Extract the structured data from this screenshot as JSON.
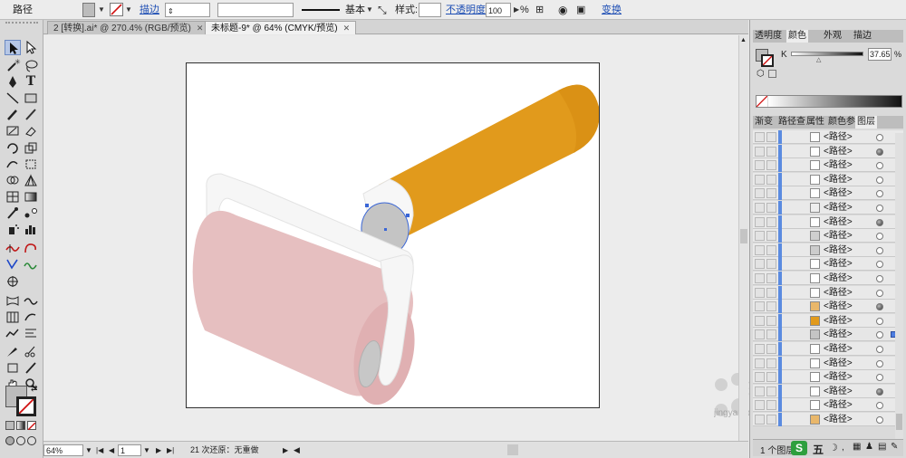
{
  "control_bar": {
    "selection_type": "路径",
    "stroke_link": "描边",
    "stroke_profile": "基本",
    "style_label": "样式:",
    "opacity_link": "不透明度",
    "opacity_value": "100",
    "opacity_unit": "%",
    "transform_link": "变换"
  },
  "tabs": [
    {
      "label": "2 [转换].ai* @ 270.4% (RGB/预览)",
      "close": "✕"
    },
    {
      "label": "未标题-9* @ 64% (CMYK/预览)",
      "close": "✕"
    }
  ],
  "status_bar": {
    "zoom": "64%",
    "page": "1",
    "undo_text": "21 次还原：无重做"
  },
  "color_panel": {
    "tabs": [
      "透明度",
      "颜色",
      "外观",
      "描边"
    ],
    "active_tab": "颜色",
    "channel_label": "K",
    "channel_value": "37.65",
    "channel_unit": "%"
  },
  "layers_panel": {
    "tabs": [
      "渐变",
      "路径查",
      "属性",
      "颜色参",
      "图层"
    ],
    "active_tab": "图层",
    "row_label": "<路径>",
    "rows": [
      {
        "name": "<路径>",
        "thumb_color": "#ffffff",
        "filled": false
      },
      {
        "name": "<路径>",
        "thumb_color": "#ffffff",
        "filled": true
      },
      {
        "name": "<路径>",
        "thumb_color": "#ffffff",
        "filled": false
      },
      {
        "name": "<路径>",
        "thumb_color": "#ffffff",
        "filled": false
      },
      {
        "name": "<路径>",
        "thumb_color": "#ffffff",
        "filled": false
      },
      {
        "name": "<路径>",
        "thumb_color": "#eeeeee",
        "filled": false
      },
      {
        "name": "<路径>",
        "thumb_color": "#ffffff",
        "filled": true
      },
      {
        "name": "<路径>",
        "thumb_color": "#cfcfcf",
        "filled": false
      },
      {
        "name": "<路径>",
        "thumb_color": "#cccccc",
        "filled": false
      },
      {
        "name": "<路径>",
        "thumb_color": "#ffffff",
        "filled": false
      },
      {
        "name": "<路径>",
        "thumb_color": "#ffffff",
        "filled": false
      },
      {
        "name": "<路径>",
        "thumb_color": "#ffffff",
        "filled": false
      },
      {
        "name": "<路径>",
        "thumb_color": "#e9b76a",
        "filled": true
      },
      {
        "name": "<路径>",
        "thumb_color": "#e19a1c",
        "filled": false
      },
      {
        "name": "<路径>",
        "thumb_color": "#c4c4c4",
        "filled": false,
        "selected": true
      },
      {
        "name": "<路径>",
        "thumb_color": "#ffffff",
        "filled": false
      },
      {
        "name": "<路径>",
        "thumb_color": "#ffffff",
        "filled": false
      },
      {
        "name": "<路径>",
        "thumb_color": "#ffffff",
        "filled": false
      },
      {
        "name": "<路径>",
        "thumb_color": "#ffffff",
        "filled": true
      },
      {
        "name": "<路径>",
        "thumb_color": "#ffffff",
        "filled": false
      },
      {
        "name": "<路径>",
        "thumb_color": "#e9b76a",
        "filled": false
      }
    ],
    "footer_text": "1 个图层",
    "footer_icon_char": "五"
  },
  "watermark": {
    "text": "经验",
    "subtext": "jingyan.baidu.com"
  },
  "colors": {
    "handle_orange": "#e19a1c",
    "roller_pink": "#e6bfc0",
    "frame_white": "#f6f6f6",
    "cap_gray": "#c4c4c4",
    "selection_blue": "#3a66d6"
  }
}
